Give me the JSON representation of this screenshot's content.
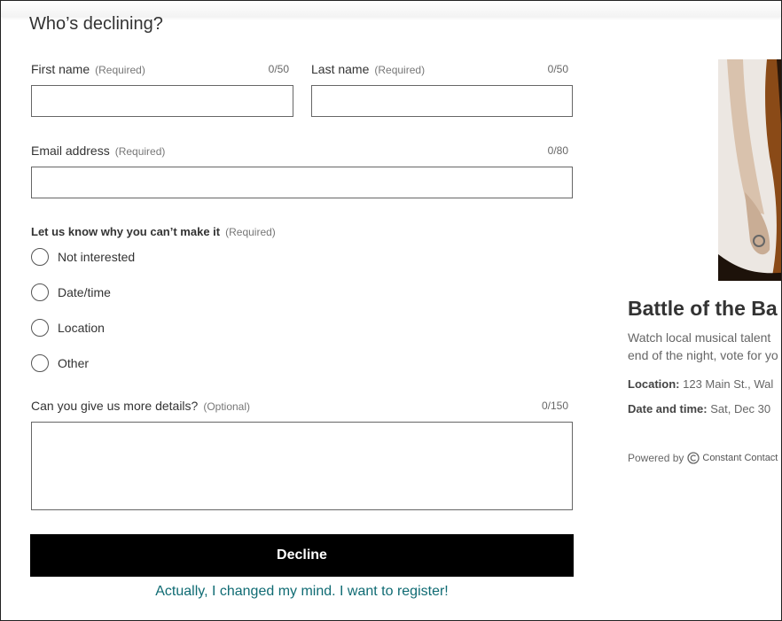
{
  "form": {
    "heading": "Who’s declining?",
    "first_name": {
      "label": "First name",
      "req": "(Required)",
      "counter": "0/50",
      "value": ""
    },
    "last_name": {
      "label": "Last name",
      "req": "(Required)",
      "counter": "0/50",
      "value": ""
    },
    "email": {
      "label": "Email address",
      "req": "(Required)",
      "counter": "0/80",
      "value": ""
    },
    "reason": {
      "label": "Let us know why you can’t make it",
      "req": "(Required)",
      "options": [
        "Not interested",
        "Date/time",
        "Location",
        "Other"
      ]
    },
    "details": {
      "label": "Can you give us more details?",
      "req": "(Optional)",
      "counter": "0/150",
      "value": ""
    },
    "decline_label": "Decline",
    "register_link": "Actually, I changed my mind. I want to register!"
  },
  "event": {
    "title": "Battle of the Ba",
    "description_line1": "Watch local musical talent",
    "description_line2": "end of the night, vote for yo",
    "location_label": "Location:",
    "location_value": "123 Main St., Wal",
    "datetime_label": "Date and time:",
    "datetime_value": "Sat, Dec 30",
    "powered_by": "Powered by",
    "brand": "Constant Contact"
  },
  "colors": {
    "link": "#0f6b73",
    "button_bg": "#000000"
  }
}
